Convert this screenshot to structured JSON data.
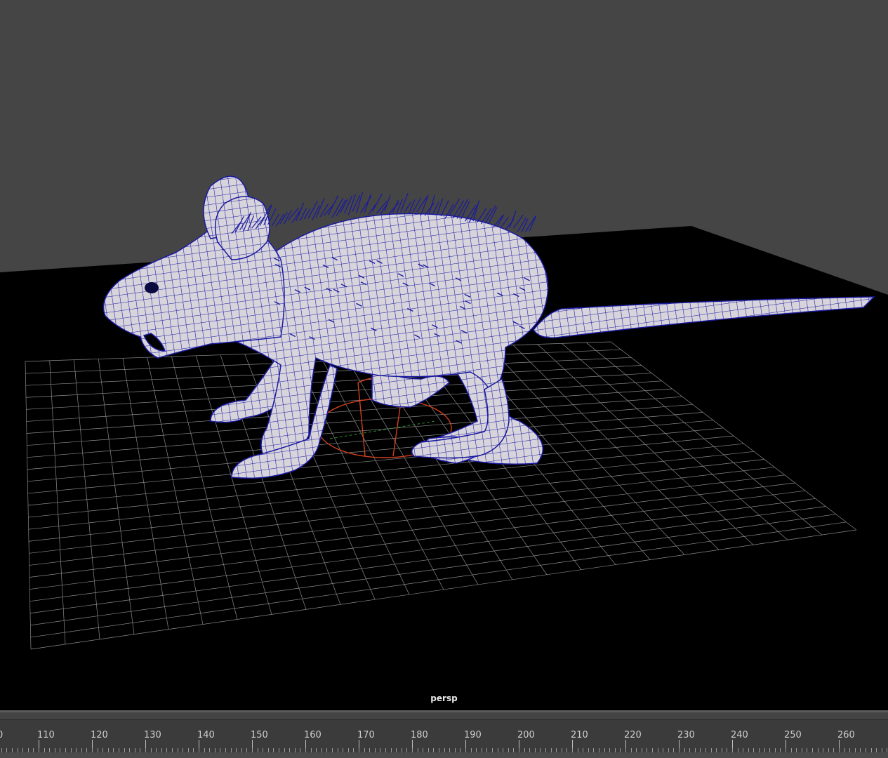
{
  "viewport": {
    "camera_label": "persp",
    "background_color": "#454545",
    "ground_color": "#000000",
    "grid_color": "#8a8a8a",
    "wireframe_color": "#1a1aa0",
    "mesh_color": "#d8d4dc"
  },
  "time_slider": {
    "frames": [
      "110",
      "120",
      "130",
      "140",
      "150",
      "160",
      "170",
      "180",
      "190",
      "200",
      "210",
      "220",
      "230",
      "240",
      "250",
      "260"
    ],
    "partial_frame": "0"
  }
}
